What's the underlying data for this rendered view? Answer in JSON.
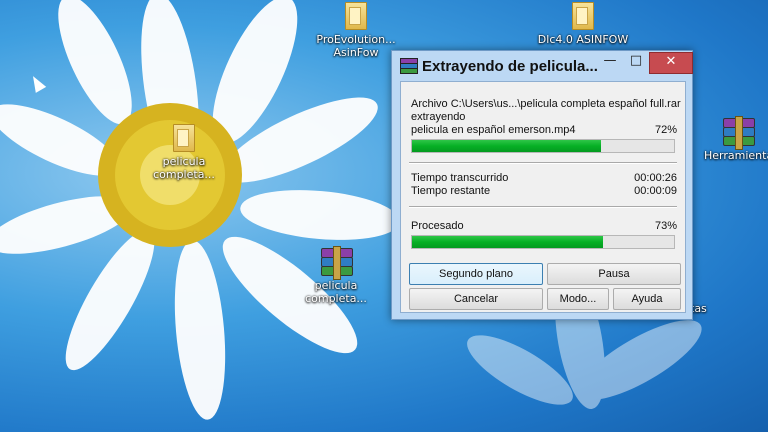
{
  "desktop": {
    "icons": [
      {
        "label_line1": "ProEvolution...",
        "label_line2": "AsinFow",
        "icon": "folder-icon"
      },
      {
        "label_line1": "Dlc4.0 ASINFOW",
        "label_line2": "",
        "icon": "folder-icon"
      },
      {
        "label_line1": "pelicula",
        "label_line2": "completa...",
        "icon": "folder-icon"
      },
      {
        "label_line1": "pelicula",
        "label_line2": "completa...",
        "icon": "winrar-archive-icon"
      },
      {
        "label_line1": "Herramienta",
        "label_line2": "",
        "icon": "winrar-archive-icon"
      },
      {
        "label_line1": "tas",
        "label_line2": "",
        "icon": ""
      }
    ]
  },
  "dialog": {
    "title": "Extrayendo de pelicula...",
    "archive_line": "Archivo C:\\Users\\us...\\pelicula completa español full.rar",
    "status_line": "extrayendo",
    "file_name": "pelicula en español emerson.mp4",
    "file_percent": "72%",
    "file_progress": 0.72,
    "elapsed_label": "Tiempo transcurrido",
    "elapsed_value": "00:00:26",
    "remaining_label": "Tiempo restante",
    "remaining_value": "00:00:09",
    "processed_label": "Procesado",
    "processed_percent": "73%",
    "processed_progress": 0.73,
    "buttons": {
      "background": "Segundo plano",
      "pause": "Pausa",
      "cancel": "Cancelar",
      "mode": "Modo...",
      "help": "Ayuda"
    },
    "progress_color": "#06b025",
    "close_color": "#c74b50"
  }
}
